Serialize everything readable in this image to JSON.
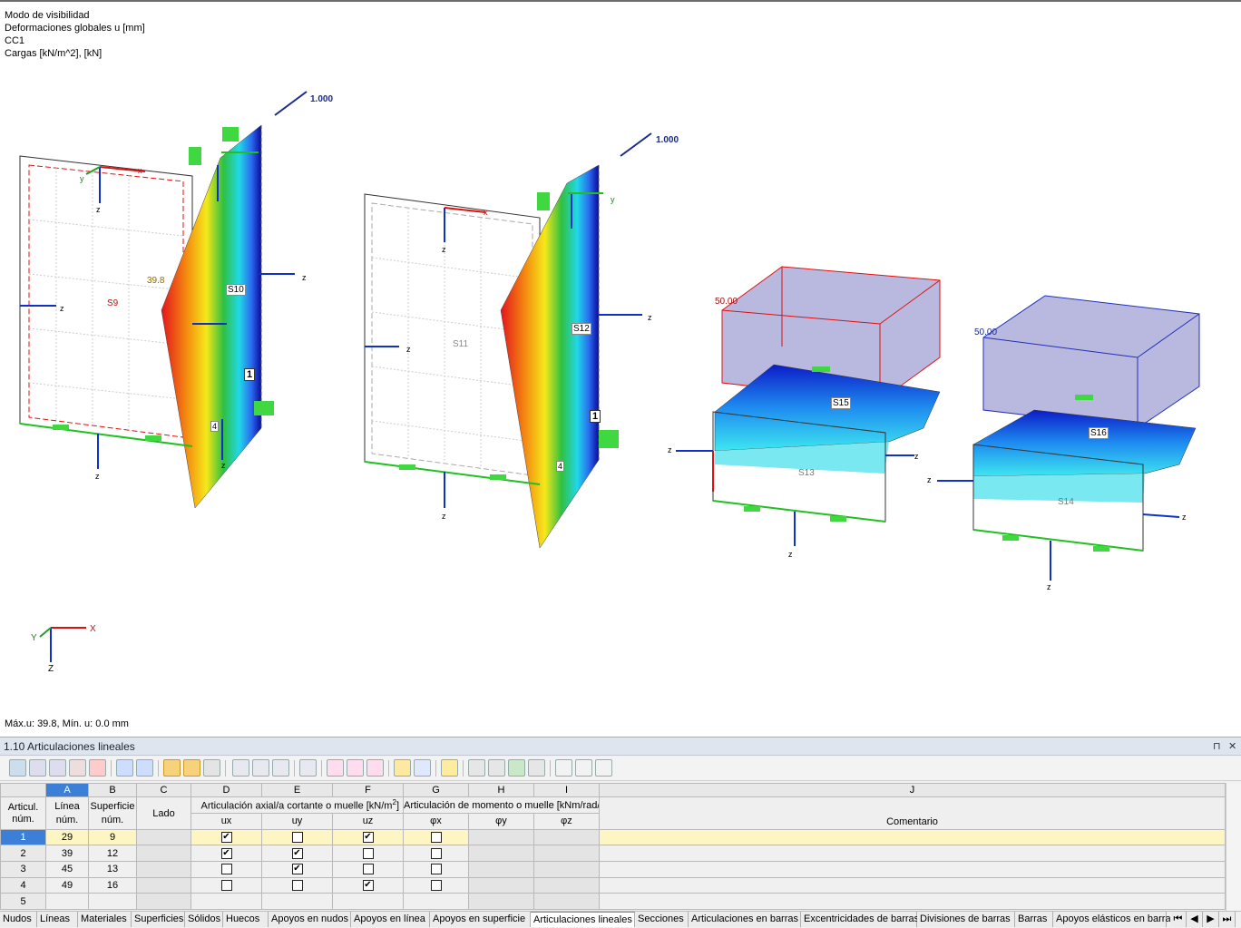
{
  "viewport": {
    "info": [
      "Modo de visibilidad",
      "Deformaciones globales u [mm]",
      "CC1",
      "Cargas [kN/m^2], [kN]"
    ],
    "status": "Máx.u: 39.8, Mín. u: 0.0 mm",
    "load_labels": [
      "1.000",
      "1.000",
      "50.00",
      "50.00"
    ],
    "surface_labels": [
      "S9",
      "S10",
      "S11",
      "S12",
      "S13",
      "S14",
      "S15",
      "S16"
    ],
    "value_label": "39.8",
    "axis_x": "x",
    "axis_y": "y",
    "axis_z": "z",
    "axis_X": "X",
    "axis_Y": "Y",
    "axis_Z": "Z",
    "marker_1": "1",
    "marker_4": "4",
    "colors": {
      "red": "#e8101a",
      "blue": "#1030c8",
      "green": "#28b030",
      "navy": "#1a2a8a"
    }
  },
  "panel": {
    "title": "1.10 Articulaciones lineales",
    "columns": [
      "A",
      "B",
      "C",
      "D",
      "E",
      "F",
      "G",
      "H",
      "I",
      "J"
    ],
    "header": {
      "art_num": "Articul. núm.",
      "linea": "Línea núm.",
      "superficie": "Superficie núm.",
      "lado": "Lado",
      "group_axial": "Articulación axial/a cortante o muelle [kN/m",
      "group_axial_sup": "2",
      "group_axial_end": "]",
      "group_moment": "Articulación de momento o muelle [kNm/rad/m",
      "ux": "ux",
      "uy": "uy",
      "uz": "uz",
      "phx": "φx",
      "phy": "φy",
      "phz": "φz",
      "comentario": "Comentario"
    },
    "rows": [
      {
        "num": "1",
        "linea": "29",
        "sup": "9",
        "ux": true,
        "uy": false,
        "uz": true,
        "phx": false
      },
      {
        "num": "2",
        "linea": "39",
        "sup": "12",
        "ux": true,
        "uy": true,
        "uz": false,
        "phx": false
      },
      {
        "num": "3",
        "linea": "45",
        "sup": "13",
        "ux": false,
        "uy": true,
        "uz": false,
        "phx": false
      },
      {
        "num": "4",
        "linea": "49",
        "sup": "16",
        "ux": false,
        "uy": false,
        "uz": true,
        "phx": false
      },
      {
        "num": "5",
        "linea": "",
        "sup": "",
        "ux": null,
        "uy": null,
        "uz": null,
        "phx": null
      }
    ],
    "check_glyph": "✔",
    "tabs": [
      "Nudos",
      "Líneas",
      "Materiales",
      "Superficies",
      "Sólidos",
      "Huecos",
      "Apoyos en nudos",
      "Apoyos en línea",
      "Apoyos en superficie",
      "Articulaciones lineales",
      "Secciones",
      "Articulaciones en barras",
      "Excentricidades de barras",
      "Divisiones de barras",
      "Barras",
      "Apoyos elásticos en barra"
    ],
    "active_tab": "Articulaciones lineales",
    "pin_icon": "pin-icon",
    "close_icon": "close-icon",
    "pin_glyph": "⊓",
    "close_glyph": "✕"
  }
}
